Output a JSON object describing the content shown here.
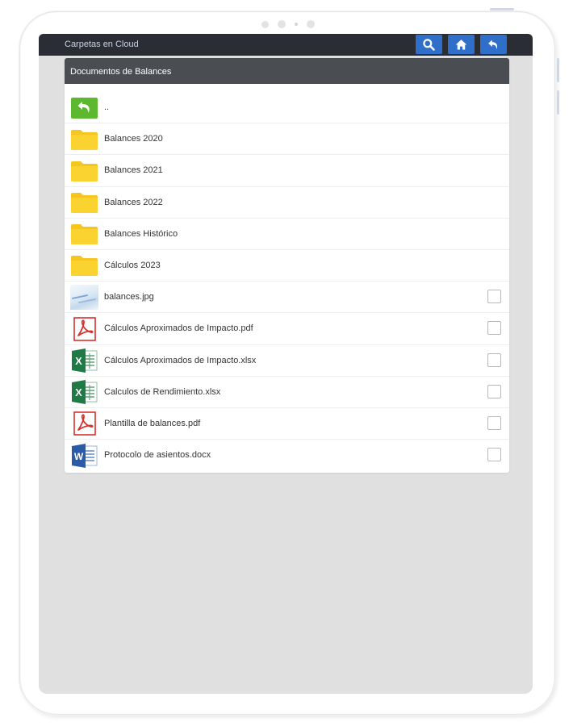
{
  "header": {
    "app_title": "Carpetas en Cloud"
  },
  "panel": {
    "title": "Documentos de Balances"
  },
  "items": [
    {
      "type": "back",
      "icon": "back-arrow-icon",
      "label": "..",
      "checkbox": false
    },
    {
      "type": "folder",
      "icon": "folder-icon",
      "label": "Balances 2020",
      "checkbox": false
    },
    {
      "type": "folder",
      "icon": "folder-icon",
      "label": "Balances 2021",
      "checkbox": false
    },
    {
      "type": "folder",
      "icon": "folder-icon",
      "label": "Balances 2022",
      "checkbox": false
    },
    {
      "type": "folder",
      "icon": "folder-icon",
      "label": "Balances Histórico",
      "checkbox": false
    },
    {
      "type": "folder",
      "icon": "folder-icon",
      "label": "Cálculos 2023",
      "checkbox": false
    },
    {
      "type": "image",
      "icon": "image-thumbnail-icon",
      "label": "balances.jpg",
      "checkbox": true
    },
    {
      "type": "pdf",
      "icon": "pdf-icon",
      "label": "Cálculos Aproximados de Impacto.pdf",
      "checkbox": true
    },
    {
      "type": "xlsx",
      "icon": "excel-icon",
      "label": "Cálculos Aproximados de Impacto.xlsx",
      "checkbox": true
    },
    {
      "type": "xlsx",
      "icon": "excel-icon",
      "label": "Calculos de Rendimiento.xlsx",
      "checkbox": true
    },
    {
      "type": "pdf",
      "icon": "pdf-icon",
      "label": "Plantilla de balances.pdf",
      "checkbox": true
    },
    {
      "type": "docx",
      "icon": "word-icon",
      "label": "Protocolo de asientos.docx",
      "checkbox": true
    }
  ],
  "colors": {
    "topbar": "#2a2d33",
    "button_blue": "#2f6fca",
    "panel_header": "#4a4d52",
    "folder_yellow": "#f7c520",
    "back_green": "#5cb82e",
    "pdf_red": "#d6322d",
    "excel_green": "#1f7a45",
    "word_blue": "#2b5aa8"
  }
}
